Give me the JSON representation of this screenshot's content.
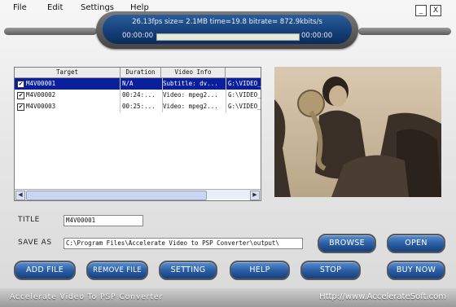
{
  "menu": {
    "file": "File",
    "edit": "Edit",
    "settings": "Settings",
    "help": "Help"
  },
  "window": {
    "minimize": "_",
    "close": "X"
  },
  "status": {
    "text": "26.13fps size=  2.1MB time=19.8 bitrate= 872.9kbits/s",
    "time_elapsed": "00:00:00",
    "time_total": "00:00:00",
    "progress": 0
  },
  "table": {
    "headers": [
      "Target",
      "Duration",
      "Video Info",
      ""
    ],
    "rows": [
      {
        "target": "M4V00001",
        "duration": "N/A",
        "video_info": "Subtitle: dv...",
        "path": "G:\\VIDEO_",
        "checked": true,
        "selected": true
      },
      {
        "target": "M4V00002",
        "duration": "00:24:...",
        "video_info": "Video: mpeg2...",
        "path": "G:\\VIDEO_",
        "checked": true,
        "selected": false
      },
      {
        "target": "M4V00003",
        "duration": "00:25:...",
        "video_info": "Video: mpeg2...",
        "path": "G:\\VIDEO_",
        "checked": true,
        "selected": false
      }
    ]
  },
  "form": {
    "title_label": "Title",
    "title_value": "M4V00001",
    "save_as_label": "Save As",
    "save_as_value": "C:\\Program Files\\Accelerate Video to PSP Converter\\output\\"
  },
  "buttons": {
    "browse": "BROWSE",
    "open": "OPEN",
    "add_file": "ADD FILE",
    "remove_file": "REMOVE FILE",
    "setting": "SETTING",
    "help": "HELP",
    "stop": "STOP",
    "buy_now": "BUY NOW"
  },
  "footer": {
    "app_name": "Accelerate Video To PSP Converter",
    "url": "Http://www.AccelerateSoft.com"
  },
  "colors": {
    "accent": "#2b5fa6",
    "selection": "#0a1f9c",
    "capsule": "#16407a"
  }
}
